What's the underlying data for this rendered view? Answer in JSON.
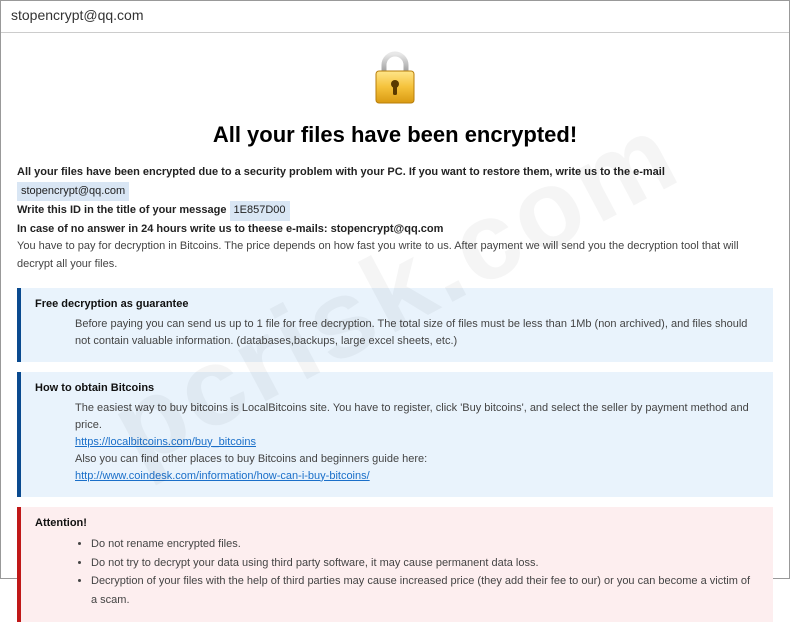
{
  "window": {
    "title": "stopencrypt@qq.com"
  },
  "heading": "All your files have been encrypted!",
  "intro": {
    "line1_prefix": "All your files have been encrypted due to a security problem with your PC. If you want to restore them, write us to the e-mail ",
    "email1": "stopencrypt@qq.com",
    "line2_prefix": "Write this ID in the title of your message ",
    "id_value": "1E857D00",
    "line3_prefix": "In case of no answer in 24 hours write us to theese e-mails: ",
    "email2": "stopencrypt@qq.com",
    "pay_line": "You have to pay for decryption in Bitcoins. The price depends on how fast you write to us. After payment we will send you the decryption tool that will decrypt all your files."
  },
  "guarantee": {
    "title": "Free decryption as guarantee",
    "body": "Before paying you can send us up to 1 file for free decryption. The total size of files must be less than 1Mb (non archived), and files should not contain valuable information. (databases,backups, large excel sheets, etc.)"
  },
  "bitcoins": {
    "title": "How to obtain Bitcoins",
    "line1": "The easiest way to buy bitcoins is LocalBitcoins site. You have to register, click 'Buy bitcoins', and select the seller by payment method and price.",
    "link1": "https://localbitcoins.com/buy_bitcoins",
    "line2": "Also you can find other places to buy Bitcoins and beginners guide here:",
    "link2": "http://www.coindesk.com/information/how-can-i-buy-bitcoins/"
  },
  "attention": {
    "title": "Attention!",
    "items": [
      "Do not rename encrypted files.",
      "Do not try to decrypt your data using third party software, it may cause permanent data loss.",
      "Decryption of your files with the help of third parties may cause increased price (they add their fee to our) or you can become a victim of a scam."
    ]
  },
  "watermark": "pcrisk.com"
}
